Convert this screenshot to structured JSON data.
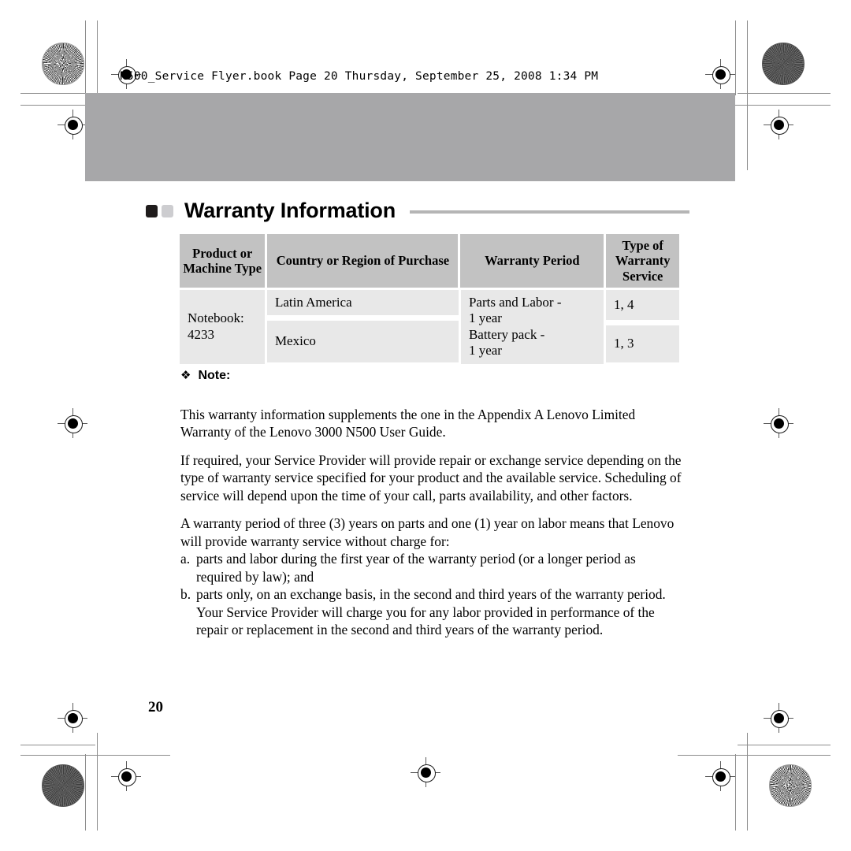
{
  "print_header": {
    "text": "N500_Service Flyer.book  Page 20  Thursday, September 25, 2008  1:34 PM"
  },
  "section": {
    "title": "Warranty Information"
  },
  "table": {
    "headers": [
      "Product or Machine Type",
      "Country or Region of Purchase",
      "Warranty Period",
      "Type of Warranty Service"
    ],
    "machine_type": "Notebook: 4233",
    "machine_type_line1": "Notebook:",
    "machine_type_line2": "4233",
    "regions": [
      "Latin America",
      "Mexico"
    ],
    "warranty_period_lines": [
      "Parts and Labor -",
      "1 year",
      "Battery pack -",
      "1 year"
    ],
    "service_types": [
      "1, 4",
      "1, 3"
    ]
  },
  "note": {
    "glyph": "❖",
    "label": "Note:",
    "paragraph": "This warranty information supplements the one in the Appendix A Lenovo Limited Warranty of the Lenovo 3000 N500 User Guide."
  },
  "body": {
    "paragraph_service": "If required, your Service Provider will provide repair or exchange service depending on the type of warranty service specified for your product and the available service. Scheduling of service will depend upon the time of your call, parts availability, and other factors.",
    "paragraph_period": "A warranty period of three (3) years on parts and one (1) year on labor means that Lenovo will provide warranty service without charge for:",
    "list": [
      {
        "marker": "a.",
        "text": "parts and labor during the first year of the warranty period (or a longer period as required by law); and"
      },
      {
        "marker": "b.",
        "text": "parts only, on an exchange basis, in the second and third years of the warranty period. Your Service Provider will charge you for any labor provided in performance of the repair or replacement in the second and third years of the warranty period."
      }
    ]
  },
  "footer": {
    "page_number": "20"
  },
  "colors": {
    "masthead_band": "#a7a7a9",
    "table_header": "#c2c2c2",
    "table_cell": "#e8e8e8",
    "title_rule": "#b5b5b5",
    "bullet_dark": "#201c1c",
    "bullet_light": "#cdcdd0"
  }
}
